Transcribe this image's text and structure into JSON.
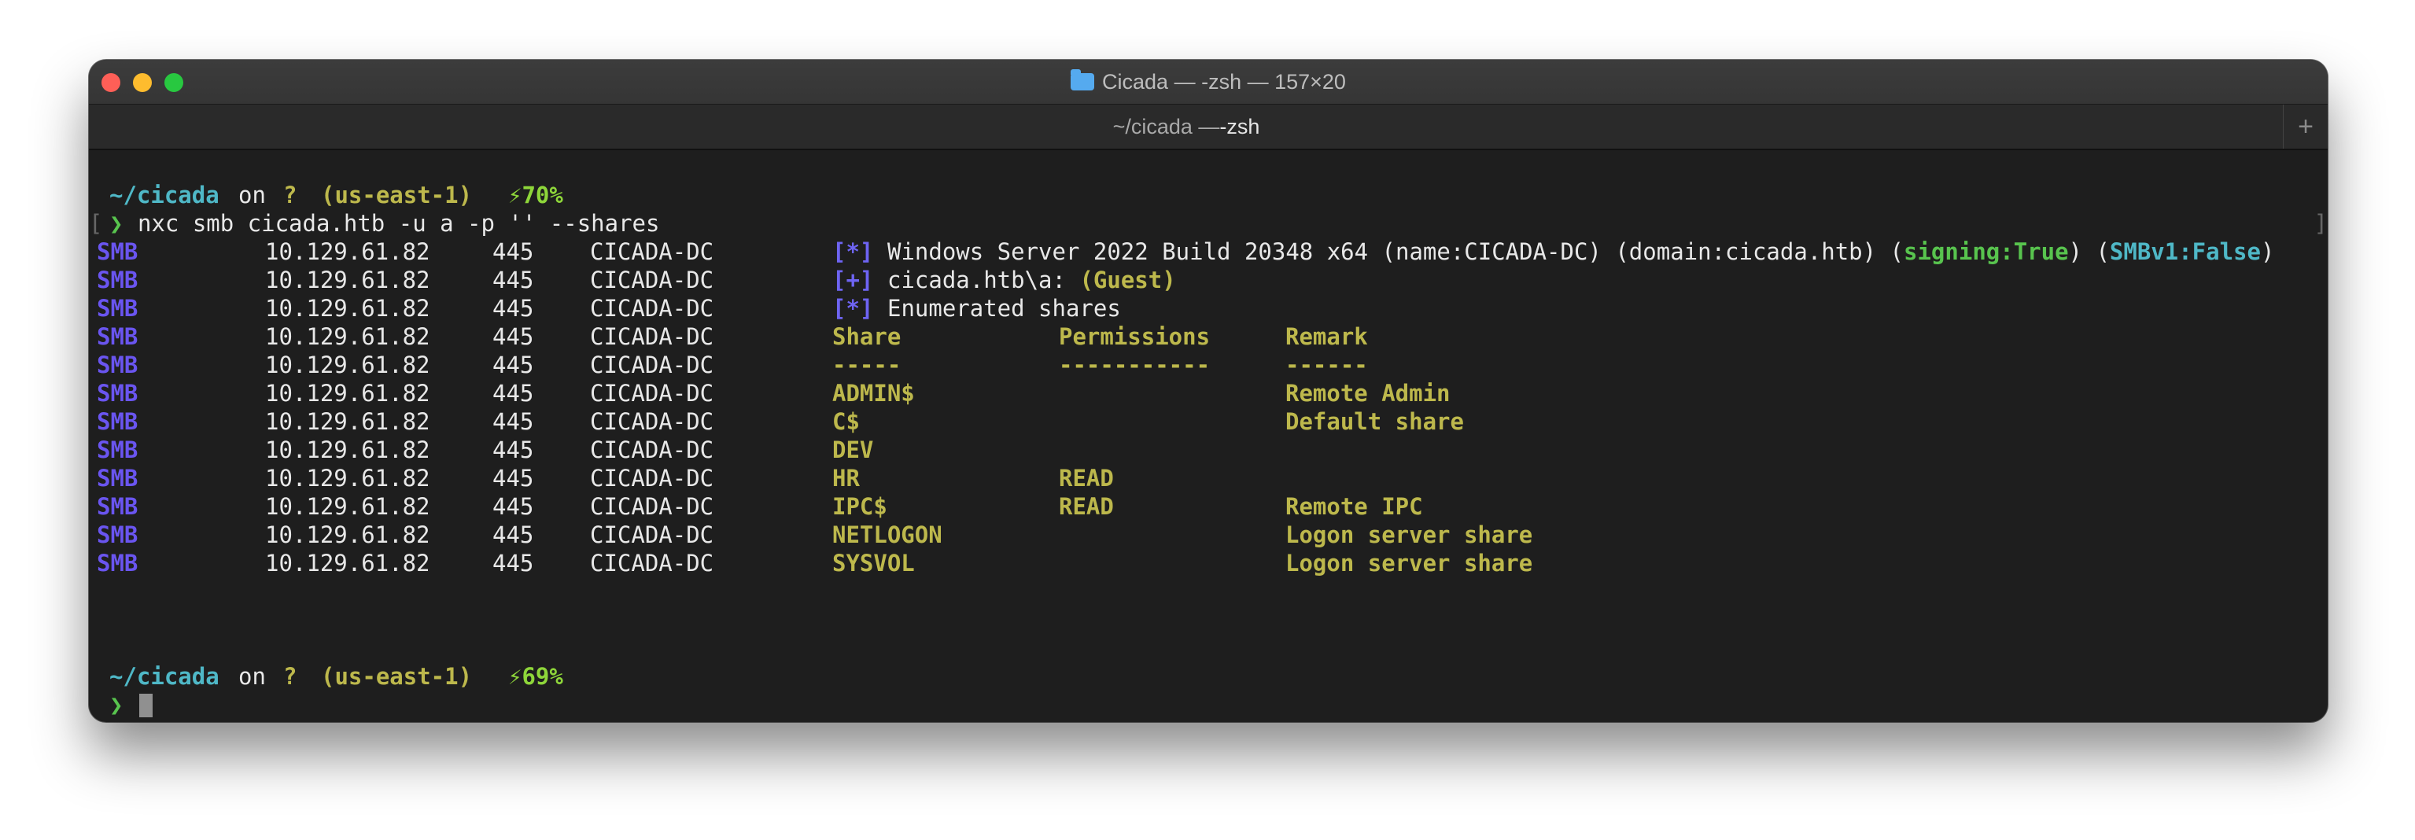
{
  "window": {
    "title": "Cicada — -zsh — 157×20",
    "tab": {
      "dir": "~/cicada — ",
      "cmd": "-zsh"
    },
    "newtab_label": "+"
  },
  "prompt1": {
    "dir": "~/cicada",
    "on": "on",
    "box": "?",
    "region": "(us-east-1)",
    "battery": "⚡70%"
  },
  "command": {
    "arrow": "❯",
    "text": "nxc smb cicada.htb -u a -p '' --shares"
  },
  "info_lines": [
    {
      "tag": "[*]",
      "parts": [
        {
          "t": "Windows Server 2022 Build 20348 x64 (name:CICADA-DC) (domain:cicada.htb) (",
          "s": "plain"
        },
        {
          "t": "signing:True",
          "s": "gstr"
        },
        {
          "t": ") (",
          "s": "plain"
        },
        {
          "t": "SMBv1:False",
          "s": "cyan"
        },
        {
          "t": ")",
          "s": "plain"
        }
      ]
    },
    {
      "tag": "[+]",
      "parts": [
        {
          "t": "cicada.htb\\a: ",
          "s": "plain"
        },
        {
          "t": "(Guest)",
          "s": "yellow"
        }
      ]
    },
    {
      "tag": "[*]",
      "parts": [
        {
          "t": "Enumerated shares",
          "s": "plain"
        }
      ]
    }
  ],
  "rows_prefix": {
    "proto": "SMB",
    "ip": "10.129.61.82",
    "port": "445",
    "host": "CICADA-DC"
  },
  "shares_header": {
    "share": "Share",
    "perm": "Permissions",
    "remark": "Remark"
  },
  "shares_sep": {
    "share": "-----",
    "perm": "-----------",
    "remark": "------"
  },
  "shares": [
    {
      "share": "ADMIN$",
      "perm": "",
      "remark": "Remote Admin"
    },
    {
      "share": "C$",
      "perm": "",
      "remark": "Default share"
    },
    {
      "share": "DEV",
      "perm": "",
      "remark": ""
    },
    {
      "share": "HR",
      "perm": "READ",
      "remark": ""
    },
    {
      "share": "IPC$",
      "perm": "READ",
      "remark": "Remote IPC"
    },
    {
      "share": "NETLOGON",
      "perm": "",
      "remark": "Logon server share"
    },
    {
      "share": "SYSVOL",
      "perm": "",
      "remark": "Logon server share"
    }
  ],
  "prompt2": {
    "dir": "~/cicada",
    "on": "on",
    "box": "?",
    "region": "(us-east-1)",
    "battery": "⚡69%"
  },
  "prompt_arrow": "❯",
  "colors": {
    "close": "#fe5f57",
    "minimize": "#febc2e",
    "maximize": "#28c840",
    "smb_purple": "#6a55f0",
    "dir_cyan": "#4fb8c7",
    "share_yellow": "#bdb84c",
    "battery_green": "#8ed63a",
    "signing_green": "#58c44e"
  }
}
